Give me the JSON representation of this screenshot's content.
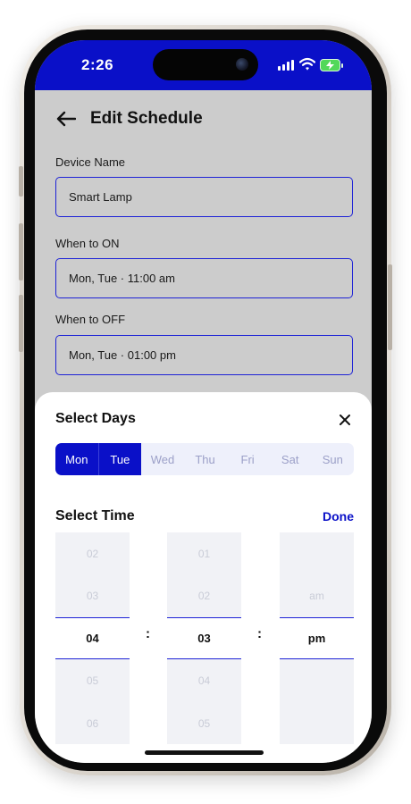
{
  "status_bar": {
    "time": "2:26",
    "icons": [
      "signal-icon",
      "wifi-icon",
      "battery-charging-icon"
    ],
    "bg_color": "#0a10c8"
  },
  "header": {
    "title": "Edit Schedule",
    "back_icon": "arrow-left-icon"
  },
  "form": {
    "device_name_label": "Device Name",
    "device_name_value": "Smart Lamp",
    "on_label": "When to ON",
    "on_value": "Mon, Tue · 11:00 am",
    "off_label": "When to OFF",
    "off_value": "Mon, Tue · 01:00 pm"
  },
  "sheet": {
    "days_title": "Select Days",
    "close_icon": "close-icon",
    "days": [
      {
        "label": "Mon",
        "selected": true
      },
      {
        "label": "Tue",
        "selected": true
      },
      {
        "label": "Wed",
        "selected": false
      },
      {
        "label": "Thu",
        "selected": false
      },
      {
        "label": "Fri",
        "selected": false
      },
      {
        "label": "Sat",
        "selected": false
      },
      {
        "label": "Sun",
        "selected": false
      }
    ],
    "time_title": "Select Time",
    "done_label": "Done",
    "separator": ":",
    "hours": [
      "02",
      "03",
      "04",
      "05",
      "06"
    ],
    "minutes": [
      "01",
      "02",
      "03",
      "04",
      "05"
    ],
    "period": [
      "am",
      "pm"
    ],
    "selected": {
      "hour": "04",
      "minute": "03",
      "period": "pm"
    }
  },
  "colors": {
    "accent": "#0a10c8",
    "page_bg": "#cccccc",
    "sheet_bg": "#ffffff"
  }
}
